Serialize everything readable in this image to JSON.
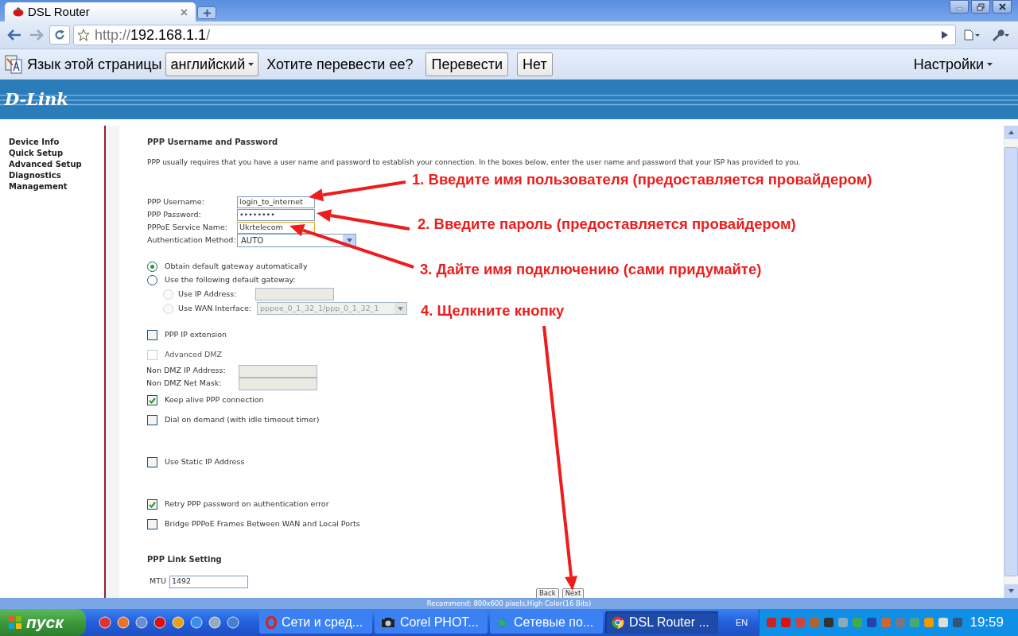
{
  "browser": {
    "tab_title": "DSL Router",
    "url_scheme": "http://",
    "url_host": "192.168.1.1",
    "url_path": "/"
  },
  "translate_bar": {
    "label": "Язык этой страницы",
    "language": "английский",
    "question": "Хотите перевести ее?",
    "translate_button": "Перевести",
    "no_button": "Нет",
    "settings": "Настройки"
  },
  "router": {
    "logo": "D-Link",
    "nav": [
      "Device Info",
      "Quick Setup",
      "Advanced Setup",
      "Diagnostics",
      "Management"
    ],
    "title": "PPP Username and Password",
    "description": "PPP usually requires that you have a user name and password to establish your connection. In the boxes below, enter the user name and password that your ISP has provided to you.",
    "fields": [
      {
        "kind": "text",
        "label": "PPP Username:",
        "value": "login_to_internet"
      },
      {
        "kind": "password",
        "label": "PPP Password:",
        "value": "••••••••"
      },
      {
        "kind": "text",
        "label": "PPPoE Service Name:",
        "value": "Ukrtelecom"
      },
      {
        "kind": "select",
        "label": "Authentication Method:",
        "value": "AUTO"
      }
    ],
    "gateway": [
      {
        "label": "Obtain default gateway automatically",
        "selected": true
      },
      {
        "label": "Use the following default gateway:",
        "selected": false
      }
    ],
    "gateway_options": [
      {
        "kind": "input",
        "label": "Use IP Address:",
        "selected": false,
        "disabled": true
      },
      {
        "kind": "select",
        "label": "Use WAN Interface:",
        "value": "pppoe_0_1_32_1/ppp_0_1_32_1",
        "selected": false,
        "disabled": true
      }
    ],
    "ip_extension": {
      "label": "PPP IP extension",
      "checked": false,
      "disabled": false
    },
    "dmz": {
      "label": "Advanced DMZ",
      "checked": false,
      "disabled": true
    },
    "dmz_fields": [
      "Non DMZ IP Address:",
      "Non DMZ Net Mask:"
    ],
    "options": [
      {
        "label": "Keep alive PPP connection",
        "checked": true,
        "disabled": false
      },
      {
        "label": "Dial on demand (with idle timeout timer)",
        "checked": false,
        "disabled": false
      },
      {
        "label": "Use Static IP Address",
        "checked": false,
        "disabled": false
      },
      {
        "label": "Retry PPP password on authentication error",
        "checked": true,
        "disabled": false
      },
      {
        "label": "Bridge PPPoE Frames Between WAN and Local Ports",
        "checked": false,
        "disabled": false
      }
    ],
    "link_title": "PPP Link Setting",
    "mtu_label": "MTU",
    "mtu_value": "1492",
    "buttons": [
      "Back",
      "Next"
    ]
  },
  "status_bar": "Recommend: 800x600 pixels,High Color(16 Bits)",
  "annotations": [
    "1. Введите имя пользователя (предоставляется провайдером)",
    "2. Введите пароль (предоставляется провайдером)",
    "3. Дайте имя подключению (сами придумайте)",
    "4. Щелкните кнопку"
  ],
  "taskbar": {
    "start": "пуск",
    "tasks": [
      {
        "label": "Сети и сред...",
        "selected": false
      },
      {
        "label": "Corel PHOT...",
        "selected": false
      },
      {
        "label": "Сетевые по...",
        "selected": false
      },
      {
        "label": "DSL Router ...",
        "selected": true
      }
    ],
    "language": "EN",
    "clock": "19:59"
  }
}
